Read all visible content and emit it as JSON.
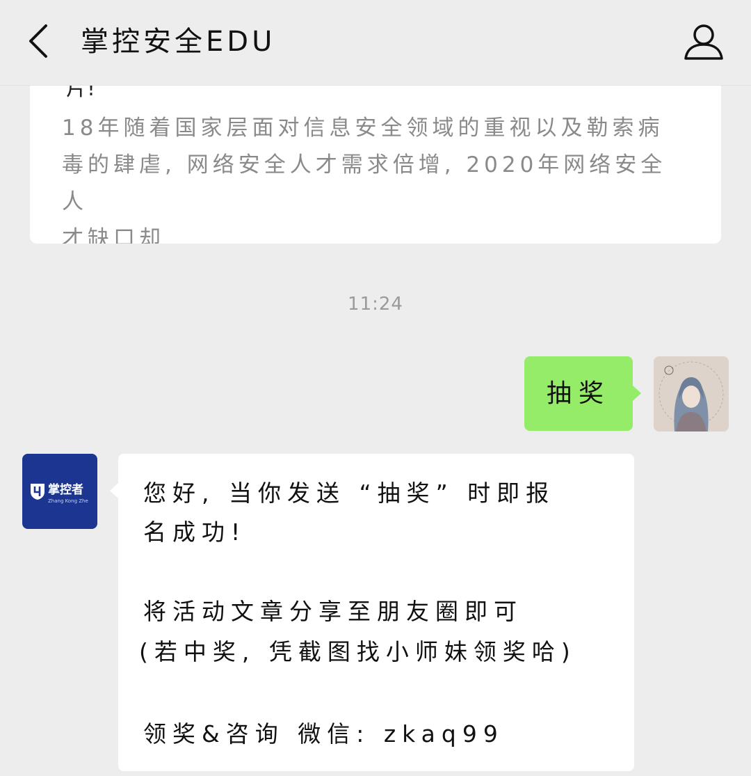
{
  "header": {
    "title": "掌控安全EDU",
    "back_icon": "chevron-left-icon",
    "profile_icon": "person-icon"
  },
  "article": {
    "tail_text": "片!",
    "summary_line1": "18年随着国家层面对信息安全领域的重视以及勒索病",
    "summary_line2": "毒的肆虐, 网络安全人才需求倍增, 2020年网络安全人",
    "summary_line3": "才缺口却"
  },
  "timestamp": "11:24",
  "outgoing": {
    "text": "抽奖",
    "bubble_color": "#95ec69"
  },
  "bot": {
    "logo_text": "掌控者",
    "logo_subtext": "Zhang Kong Zhe",
    "brand_color": "#1b3591"
  },
  "incoming": {
    "line1": "您好, 当你发送 “抽奖” 时即报",
    "line2": "名成功!",
    "line3": "将活动文章分享至朋友圈即可",
    "line4": "(若中奖, 凭截图找小师妹领奖哈)",
    "line5": "领奖&咨询 微信: zkaq99"
  }
}
